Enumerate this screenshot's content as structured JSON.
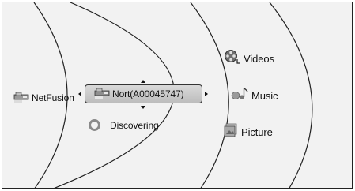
{
  "menu": {
    "source": {
      "label": "NetFusion",
      "icon": "network-device-icon"
    },
    "device": {
      "label": "Nort(A00045747)",
      "icon": "network-device-icon",
      "selected": true
    },
    "status": {
      "label": "Discovering",
      "icon": "spinner-icon"
    },
    "media": [
      {
        "label": "Videos",
        "icon": "film-reel-icon"
      },
      {
        "label": "Music",
        "icon": "music-note-icon"
      },
      {
        "label": "Picture",
        "icon": "picture-icon"
      }
    ]
  },
  "colors": {
    "background": "#f2f2f2",
    "arc_line": "#222222",
    "selection_fill": "#c8c8c8",
    "icon_grey": "#8a8a8a"
  }
}
